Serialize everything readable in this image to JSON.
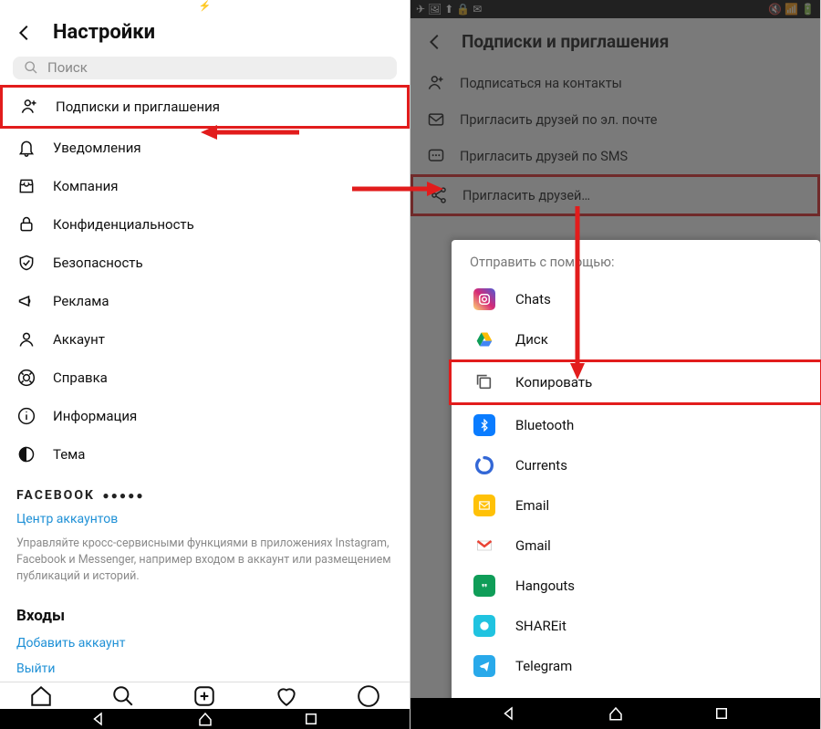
{
  "left": {
    "status_glyph": "⚡",
    "header_title": "Настройки",
    "search_placeholder": "Поиск",
    "menu": [
      {
        "label": "Подписки и приглашения",
        "icon": "follow",
        "hl": true
      },
      {
        "label": "Уведомления",
        "icon": "bell",
        "hl": false
      },
      {
        "label": "Компания",
        "icon": "store",
        "hl": false
      },
      {
        "label": "Конфиденциальность",
        "icon": "lock",
        "hl": false
      },
      {
        "label": "Безопасность",
        "icon": "shield",
        "hl": false
      },
      {
        "label": "Реклама",
        "icon": "megaphone",
        "hl": false
      },
      {
        "label": "Аккаунт",
        "icon": "account",
        "hl": false
      },
      {
        "label": "Справка",
        "icon": "help",
        "hl": false
      },
      {
        "label": "Информация",
        "icon": "info",
        "hl": false
      },
      {
        "label": "Тема",
        "icon": "theme",
        "hl": false
      }
    ],
    "fb_title": "FACEBOOK",
    "accounts_center": "Центр аккаунтов",
    "desc": "Управляйте кросс-сервисными функциями в приложениях Instagram, Facebook и Messenger, например входом в аккаунт или размещением публикаций и историй.",
    "logins_title": "Входы",
    "add_account": "Добавить аккаунт",
    "logout": "Выйти"
  },
  "right": {
    "header_title": "Подписки и приглашения",
    "invites": [
      {
        "label": "Подписаться на контакты",
        "icon": "follow",
        "hl": false
      },
      {
        "label": "Пригласить друзей по эл. почте",
        "icon": "mail",
        "hl": false
      },
      {
        "label": "Пригласить друзей по SMS",
        "icon": "sms",
        "hl": false
      },
      {
        "label": "Пригласить друзей…",
        "icon": "share",
        "hl": true
      }
    ],
    "sheet_title": "Отправить с помощью:",
    "apps": [
      {
        "label": "Chats",
        "icon": "instagram",
        "hl": false
      },
      {
        "label": "Диск",
        "icon": "gdrive",
        "hl": false
      },
      {
        "label": "Копировать",
        "icon": "copy",
        "hl": true
      },
      {
        "label": "Bluetooth",
        "icon": "bluetooth",
        "hl": false
      },
      {
        "label": "Currents",
        "icon": "currents",
        "hl": false
      },
      {
        "label": "Email",
        "icon": "email",
        "hl": false
      },
      {
        "label": "Gmail",
        "icon": "gmail",
        "hl": false
      },
      {
        "label": "Hangouts",
        "icon": "hangouts",
        "hl": false
      },
      {
        "label": "SHAREit",
        "icon": "shareit",
        "hl": false
      },
      {
        "label": "Telegram",
        "icon": "telegram",
        "hl": false
      }
    ]
  }
}
